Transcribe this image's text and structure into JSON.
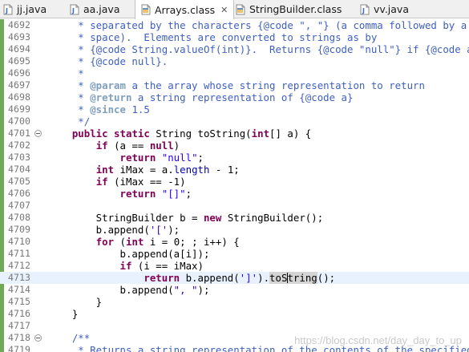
{
  "tabs": [
    {
      "label": "jj.java",
      "icon": "java-file-icon",
      "active": false,
      "closable": false
    },
    {
      "label": "aa.java",
      "icon": "java-file-icon",
      "active": false,
      "closable": false
    },
    {
      "label": "Arrays.class",
      "icon": "class-file-icon",
      "active": true,
      "closable": true
    },
    {
      "label": "StringBuilder.class",
      "icon": "class-file-icon",
      "active": false,
      "closable": false
    },
    {
      "label": "vv.java",
      "icon": "java-file-icon",
      "active": false,
      "closable": false
    }
  ],
  "close_glyph": "✕",
  "editor": {
    "current_line": 4713,
    "lines": [
      {
        "n": "4692",
        "html": "<span class=\"cm\">     * separated by the characters {@code \", \"} (a comma followed by a</span>"
      },
      {
        "n": "4693",
        "html": "<span class=\"cm\">     * space).  Elements are converted to strings as by</span>"
      },
      {
        "n": "4694",
        "html": "<span class=\"cm\">     * {@code String.valueOf(int)}.  Returns {@code \"null\"} if {@code a} is</span>"
      },
      {
        "n": "4695",
        "html": "<span class=\"cm\">     * {@code null}.</span>"
      },
      {
        "n": "4696",
        "html": "<span class=\"cm\">     *</span>"
      },
      {
        "n": "4697",
        "html": "<span class=\"cm\">     * </span><span class=\"tag\">@param</span><span class=\"cm\"> a the array whose string representation to return</span>"
      },
      {
        "n": "4698",
        "html": "<span class=\"cm\">     * </span><span class=\"tag\">@return</span><span class=\"cm\"> a string representation of {@code a}</span>"
      },
      {
        "n": "4699",
        "html": "<span class=\"cm\">     * </span><span class=\"tag\">@since</span><span class=\"cm\"> 1.5</span>"
      },
      {
        "n": "4700",
        "html": "<span class=\"cm\">     */</span>"
      },
      {
        "n": "4701",
        "fold": true,
        "html": "    <span class=\"kw\">public static</span> String toString(<span class=\"kw\">int</span>[] a) {"
      },
      {
        "n": "4702",
        "html": "        <span class=\"kw\">if</span> (a == <span class=\"kw\">null</span>)"
      },
      {
        "n": "4703",
        "html": "            <span class=\"kw\">return</span> <span class=\"str\">\"null\"</span>;"
      },
      {
        "n": "4704",
        "html": "        <span class=\"kw\">int</span> iMax = a.<span class=\"fld\">length</span> - 1;"
      },
      {
        "n": "4705",
        "html": "        <span class=\"kw\">if</span> (iMax == -1)"
      },
      {
        "n": "4706",
        "html": "            <span class=\"kw\">return</span> <span class=\"str\">\"[]\"</span>;"
      },
      {
        "n": "4707",
        "html": ""
      },
      {
        "n": "4708",
        "html": "        StringBuilder b = <span class=\"kw\">new</span> StringBuilder();"
      },
      {
        "n": "4709",
        "html": "        b.append(<span class=\"str\">'['</span>);"
      },
      {
        "n": "4710",
        "html": "        <span class=\"kw\">for</span> (<span class=\"kw\">int</span> i = 0; ; i++) {"
      },
      {
        "n": "4711",
        "html": "            b.append(a[i]);"
      },
      {
        "n": "4712",
        "html": "            <span class=\"kw\">if</span> (i == iMax)"
      },
      {
        "n": "4713",
        "html": "                <span class=\"kw\">return</span> b.append(<span class=\"str\">']'</span>).<span class=\"hl\">toS<span class=\"caret\"></span>tring</span>();"
      },
      {
        "n": "4714",
        "html": "            b.append(<span class=\"str\">\", \"</span>);"
      },
      {
        "n": "4715",
        "html": "        }"
      },
      {
        "n": "4716",
        "html": "    }"
      },
      {
        "n": "4717",
        "html": ""
      },
      {
        "n": "4718",
        "fold": true,
        "html": "    <span class=\"cm\">/**</span>"
      },
      {
        "n": "4719",
        "html": "<span class=\"cm\">     * Returns a string representation of the contents of the specified array.</span>"
      }
    ]
  },
  "watermark": "https://blog.csdn.net/day_day_to_up",
  "colors": {
    "keyword": "#7f0055",
    "string": "#2a00ff",
    "comment": "#3f5fbf",
    "javadoc_tag": "#7f9fbf",
    "field": "#0000c0",
    "current_line": "#e8f2fe",
    "change_bar": "#6fa856"
  }
}
